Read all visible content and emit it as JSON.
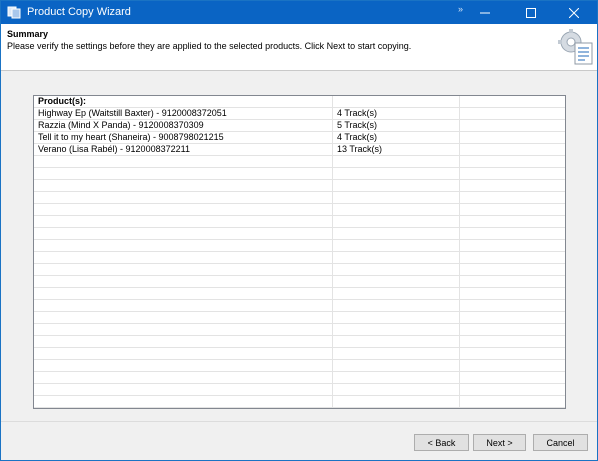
{
  "window": {
    "title": "Product Copy Wizard",
    "pin_glyph": "»",
    "accent_color": "#0a64c4"
  },
  "header": {
    "title": "Summary",
    "description": "Please verify the settings before they are applied to the selected products. Click Next to start copying.",
    "icon": "settings-checklist-icon"
  },
  "grid": {
    "header_label": "Product(s):",
    "rows": [
      {
        "product": "Highway Ep (Waitstill Baxter) - 9120008372051",
        "tracks": "4 Track(s)"
      },
      {
        "product": "Razzia (Mind X Panda) - 9120008370309",
        "tracks": "5 Track(s)"
      },
      {
        "product": "Tell it to my heart (Shaneira) - 9008798021215",
        "tracks": "4 Track(s)"
      },
      {
        "product": "Verano (Lisa Rabél) - 9120008372211",
        "tracks": "13 Track(s)"
      }
    ]
  },
  "buttons": {
    "back": "< Back",
    "next": "Next >",
    "cancel": "Cancel"
  }
}
